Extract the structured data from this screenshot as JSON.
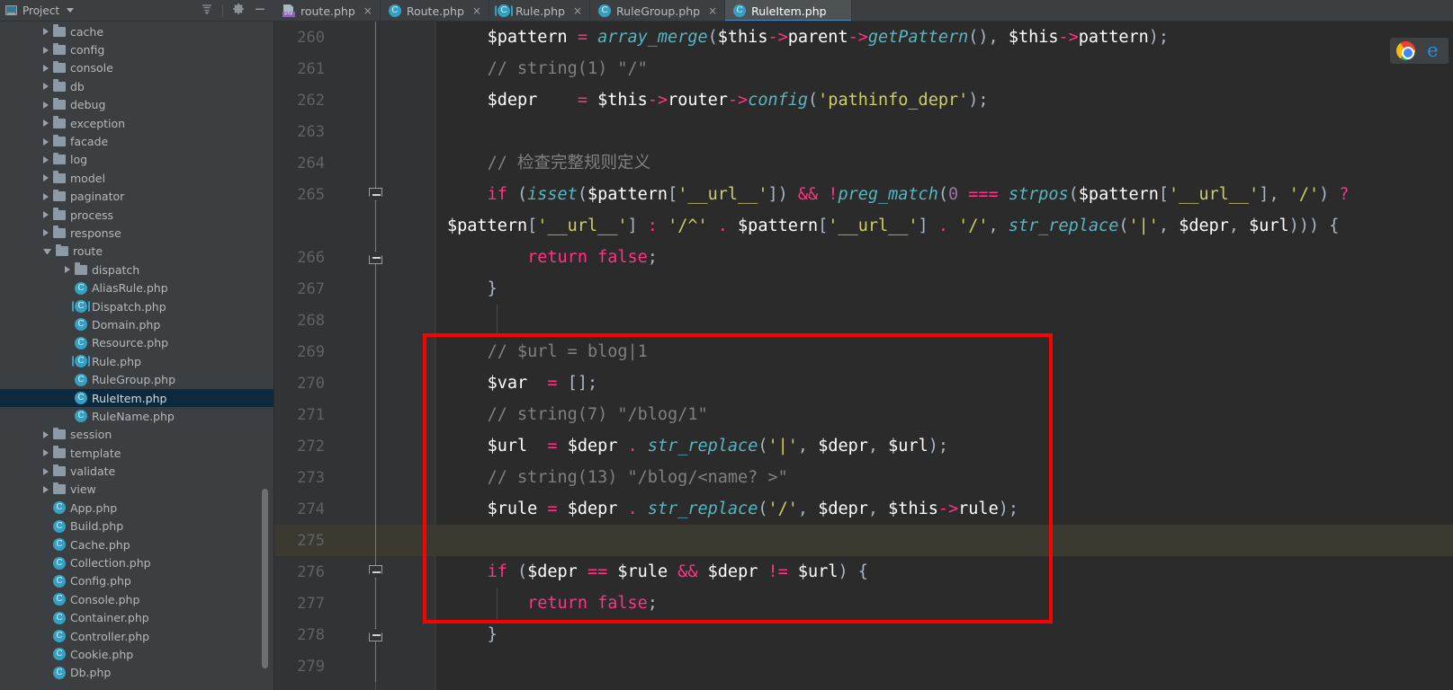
{
  "window": {
    "project_panel": {
      "title": "Project",
      "icons": [
        "collapse-all-icon",
        "gear-icon",
        "minimize-icon"
      ]
    }
  },
  "tabs": [
    {
      "label": "route.php",
      "icon": "php-file-icon",
      "active": false,
      "closable": true
    },
    {
      "label": "Route.php",
      "icon": "php-class-icon",
      "active": false,
      "closable": true
    },
    {
      "label": "Rule.php",
      "icon": "php-interface-icon",
      "active": false,
      "closable": true
    },
    {
      "label": "RuleGroup.php",
      "icon": "php-class-icon",
      "active": false,
      "closable": true
    },
    {
      "label": "RuleItem.php",
      "icon": "php-class-icon",
      "active": true,
      "closable": true
    }
  ],
  "tab_close_glyph": "×",
  "tree": [
    {
      "label": "cache",
      "type": "folder",
      "indent": 2,
      "state": "collapsed"
    },
    {
      "label": "config",
      "type": "folder",
      "indent": 2,
      "state": "collapsed"
    },
    {
      "label": "console",
      "type": "folder",
      "indent": 2,
      "state": "collapsed"
    },
    {
      "label": "db",
      "type": "folder",
      "indent": 2,
      "state": "collapsed"
    },
    {
      "label": "debug",
      "type": "folder",
      "indent": 2,
      "state": "collapsed"
    },
    {
      "label": "exception",
      "type": "folder",
      "indent": 2,
      "state": "collapsed"
    },
    {
      "label": "facade",
      "type": "folder",
      "indent": 2,
      "state": "collapsed"
    },
    {
      "label": "log",
      "type": "folder",
      "indent": 2,
      "state": "collapsed"
    },
    {
      "label": "model",
      "type": "folder",
      "indent": 2,
      "state": "collapsed"
    },
    {
      "label": "paginator",
      "type": "folder",
      "indent": 2,
      "state": "collapsed"
    },
    {
      "label": "process",
      "type": "folder",
      "indent": 2,
      "state": "collapsed"
    },
    {
      "label": "response",
      "type": "folder",
      "indent": 2,
      "state": "collapsed"
    },
    {
      "label": "route",
      "type": "folder",
      "indent": 2,
      "state": "expanded"
    },
    {
      "label": "dispatch",
      "type": "folder",
      "indent": 3,
      "state": "collapsed"
    },
    {
      "label": "AliasRule.php",
      "type": "class",
      "indent": 3,
      "state": "leaf"
    },
    {
      "label": "Dispatch.php",
      "type": "interface",
      "indent": 3,
      "state": "leaf"
    },
    {
      "label": "Domain.php",
      "type": "class",
      "indent": 3,
      "state": "leaf"
    },
    {
      "label": "Resource.php",
      "type": "class",
      "indent": 3,
      "state": "leaf"
    },
    {
      "label": "Rule.php",
      "type": "interface",
      "indent": 3,
      "state": "leaf"
    },
    {
      "label": "RuleGroup.php",
      "type": "class",
      "indent": 3,
      "state": "leaf"
    },
    {
      "label": "RuleItem.php",
      "type": "class",
      "indent": 3,
      "state": "leaf",
      "selected": true
    },
    {
      "label": "RuleName.php",
      "type": "class",
      "indent": 3,
      "state": "leaf"
    },
    {
      "label": "session",
      "type": "folder",
      "indent": 2,
      "state": "collapsed"
    },
    {
      "label": "template",
      "type": "folder",
      "indent": 2,
      "state": "collapsed"
    },
    {
      "label": "validate",
      "type": "folder",
      "indent": 2,
      "state": "collapsed"
    },
    {
      "label": "view",
      "type": "folder",
      "indent": 2,
      "state": "collapsed"
    },
    {
      "label": "App.php",
      "type": "class",
      "indent": 2,
      "state": "leaf"
    },
    {
      "label": "Build.php",
      "type": "class",
      "indent": 2,
      "state": "leaf"
    },
    {
      "label": "Cache.php",
      "type": "class",
      "indent": 2,
      "state": "leaf"
    },
    {
      "label": "Collection.php",
      "type": "class",
      "indent": 2,
      "state": "leaf"
    },
    {
      "label": "Config.php",
      "type": "class",
      "indent": 2,
      "state": "leaf"
    },
    {
      "label": "Console.php",
      "type": "class",
      "indent": 2,
      "state": "leaf"
    },
    {
      "label": "Container.php",
      "type": "class",
      "indent": 2,
      "state": "leaf"
    },
    {
      "label": "Controller.php",
      "type": "class",
      "indent": 2,
      "state": "leaf"
    },
    {
      "label": "Cookie.php",
      "type": "class",
      "indent": 2,
      "state": "leaf"
    },
    {
      "label": "Db.php",
      "type": "class",
      "indent": 2,
      "state": "leaf"
    }
  ],
  "editor": {
    "first_line": 260,
    "current_line": 275,
    "lines": [
      {
        "n": "260",
        "text": "    $pattern = array_merge($this->parent->getPattern(), $this->pattern);"
      },
      {
        "n": "261",
        "text": "    // string(1) \"/\""
      },
      {
        "n": "262",
        "text": "    $depr    = $this->router->config('pathinfo_depr');"
      },
      {
        "n": "263",
        "text": ""
      },
      {
        "n": "264",
        "text": "    // 检查完整规则定义"
      },
      {
        "n": "265",
        "text": "    if (isset($pattern['__url__']) && !preg_match(0 === strpos($pattern['__url__'], '/') ?"
      },
      {
        "n": "",
        "text": "$pattern['__url__'] : '/^' . $pattern['__url__'] . '/', str_replace('|', $depr, $url))) {"
      },
      {
        "n": "266",
        "text": "        return false;"
      },
      {
        "n": "267",
        "text": "    }"
      },
      {
        "n": "268",
        "text": ""
      },
      {
        "n": "269",
        "text": "    // $url = blog|1"
      },
      {
        "n": "270",
        "text": "    $var  = [];"
      },
      {
        "n": "271",
        "text": "    // string(7) \"/blog/1\""
      },
      {
        "n": "272",
        "text": "    $url  = $depr . str_replace('|', $depr, $url);"
      },
      {
        "n": "273",
        "text": "    // string(13) \"/blog/<name? >\""
      },
      {
        "n": "274",
        "text": "    $rule = $depr . str_replace('/', $depr, $this->rule);"
      },
      {
        "n": "275",
        "text": ""
      },
      {
        "n": "276",
        "text": "    if ($depr == $rule && $depr != $url) {"
      },
      {
        "n": "277",
        "text": "        return false;"
      },
      {
        "n": "278",
        "text": "    }"
      },
      {
        "n": "279",
        "text": ""
      }
    ]
  },
  "annotation": {
    "shape": "rectangle",
    "color": "#fe0000",
    "covers_lines": "269-278"
  },
  "browser_icons": [
    {
      "name": "chrome-icon",
      "label": "Chrome"
    },
    {
      "name": "edge-icon",
      "label": "Edge",
      "glyph": "e"
    }
  ],
  "colors": {
    "editor_bg": "#2b2b2b",
    "gutter_bg": "#313335",
    "sidebar_bg": "#3c3f41",
    "selection_bg": "#0d293e",
    "current_line_bg": "#3a3a30",
    "tab_active_bg": "#4e5254",
    "tab_underline": "#4a88c7",
    "annotation": "#fe0000",
    "keyword": "#ff3385",
    "function": "#56b6c2",
    "string": "#cfcf63",
    "comment": "#808080",
    "number": "#9876aa"
  }
}
